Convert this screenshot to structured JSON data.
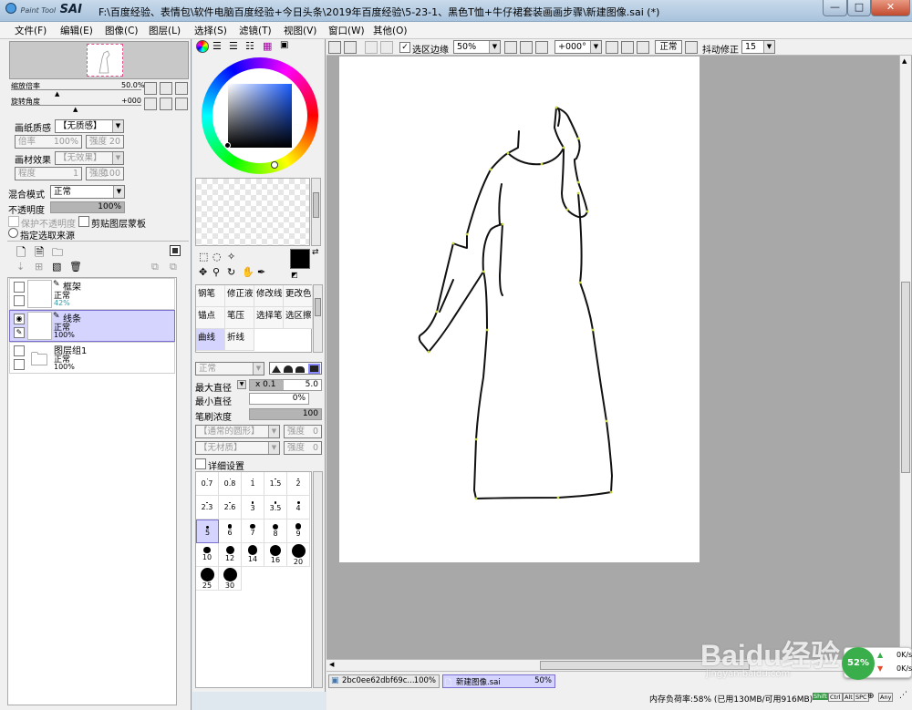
{
  "window": {
    "app_name": "Paint Tool SAI",
    "app_small": "Paint Tool",
    "app_big": "SAI",
    "title": "F:\\百度经验、表情包\\软件电脑百度经验+今日头条\\2019年百度经验\\5-23-1、黑色T恤+牛仔裙套装画画步骤\\新建图像.sai (*)",
    "min": "—",
    "max": "□",
    "close": "✕"
  },
  "menu": [
    "文件(F)",
    "编辑(E)",
    "图像(C)",
    "图层(L)",
    "选择(S)",
    "滤镜(T)",
    "视图(V)",
    "窗口(W)",
    "其他(O)"
  ],
  "navigator": {
    "zoom_label": "缩放倍率",
    "zoom_value": "50.0%",
    "rotate_label": "旋转角度",
    "rotate_value": "+000"
  },
  "paper": {
    "texture_label": "画纸质感",
    "texture_value": "【无质感】",
    "scale_label": "倍率",
    "scale_value": "100%",
    "strength_label": "强度",
    "strength_value": "20",
    "effect_label": "画材效果",
    "effect_value": "【无效果】",
    "degree_label": "程度",
    "degree_value": "1",
    "strength2_label": "强度",
    "strength2_value": "100"
  },
  "blend": {
    "mode_label": "混合模式",
    "mode_value": "正常",
    "opacity_label": "不透明度",
    "opacity_value": "100%",
    "protect_label": "保护不透明度",
    "clip_label": "剪贴图层蒙板",
    "source_label": "指定选取来源"
  },
  "layers": [
    {
      "name": "框架",
      "mode": "正常",
      "opacity": "42%",
      "selected": false
    },
    {
      "name": "线条",
      "mode": "正常",
      "opacity": "100%",
      "selected": true
    },
    {
      "name": "图层组1",
      "mode": "正常",
      "opacity": "100%",
      "selected": false
    }
  ],
  "canvas_toolbar": {
    "sel_edge": "选区边缘",
    "zoom": "50%",
    "angle": "+000°",
    "mode": "正常",
    "stab_label": "抖动修正",
    "stab_value": "15"
  },
  "tools": [
    [
      "钢笔",
      "修正液",
      "修改线",
      "更改色"
    ],
    [
      "锚点",
      "笔压",
      "选择笔",
      "选区擦"
    ],
    [
      "曲线",
      "折线",
      "",
      ""
    ]
  ],
  "brush": {
    "mode": "正常",
    "max_label": "最大直径",
    "max_mult": "x 0.1",
    "max_value": "5.0",
    "min_label": "最小直径",
    "min_value": "0%",
    "density_label": "笔刷浓度",
    "density_value": "100",
    "shape_value": "【通常的圆形】",
    "shape_strength": "强度",
    "shape_strength_val": "0",
    "tex_value": "【无材质】",
    "tex_strength": "强度",
    "tex_strength_val": "0",
    "detail_label": "详细设置"
  },
  "brush_sizes": [
    [
      "0.7",
      "0.8",
      "1",
      "1.5",
      "2"
    ],
    [
      "2.3",
      "2.6",
      "3",
      "3.5",
      "4"
    ],
    [
      "5",
      "6",
      "7",
      "8",
      "9"
    ],
    [
      "10",
      "12",
      "14",
      "16",
      "20"
    ],
    [
      "25",
      "30"
    ]
  ],
  "tabs": [
    {
      "name": "2bc0ee62dbf69c...",
      "zoom": "100%"
    },
    {
      "name": "新建图像.sai",
      "zoom": "50%"
    }
  ],
  "status": {
    "memory": "内存负荷率:58% (已用130MB/可用916MB)",
    "keys": [
      "Shift",
      "Ctrl",
      "Alt",
      "SPC",
      "Any"
    ]
  },
  "net": {
    "percent": "52%",
    "up": "0K/s",
    "down": "0K/s"
  },
  "watermark": {
    "main": "Baidu经验",
    "sub": "jingyan.baidu.com"
  },
  "colors": {
    "selected_layer": "#d4d4ff",
    "canvas_bg": "#a8a8a8",
    "paper": "#ffffff",
    "line": "#111111",
    "net_green": "#3aae4a"
  }
}
